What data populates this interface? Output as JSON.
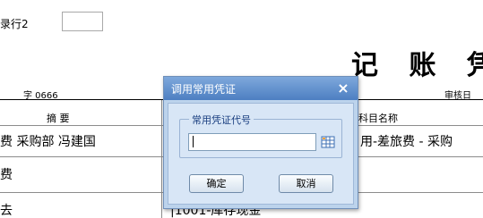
{
  "voucher": {
    "row_label": "录行2",
    "title": "记 账 凭",
    "voucher_no": "字 0666",
    "review_label": "审核日",
    "columns": {
      "summary": "摘 要",
      "account": "科目名称"
    },
    "rows": [
      {
        "summary": "费 采购部 冯建国",
        "account": "用-差旅费 - 采购"
      },
      {
        "summary": "费",
        "account": ""
      },
      {
        "summary": "去",
        "account": "|1001-库存现金"
      }
    ]
  },
  "dialog": {
    "title": "调用常用凭证",
    "close_glyph": "×",
    "group_label": "常用凭证代号",
    "code_value": "",
    "ok_label": "确定",
    "cancel_label": "取消"
  },
  "icons": {
    "close": "close-icon",
    "reference": "reference-grid-icon"
  },
  "colors": {
    "titlebar": "#4d7fc2",
    "dialog_body": "#d8e6f6",
    "group_text": "#1a3f80"
  }
}
